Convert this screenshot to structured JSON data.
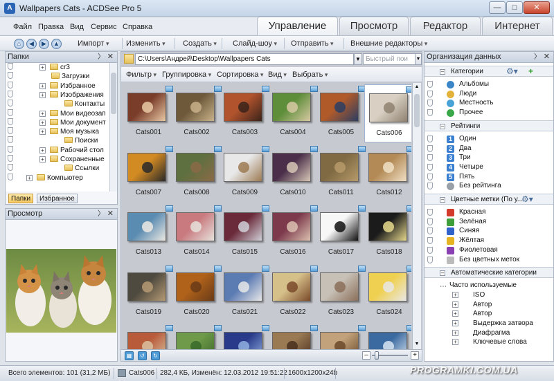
{
  "window": {
    "title": "Wallpapers Cats - ACDSee Pro 5"
  },
  "menu": [
    "Файл",
    "Правка",
    "Вид",
    "Сервис",
    "Справка"
  ],
  "modes": [
    "Управление",
    "Просмотр",
    "Редактор",
    "Интернет"
  ],
  "toolbar": [
    "Импорт",
    "Изменить",
    "Создать",
    "Слайд-шоу",
    "Отправить",
    "Внешние редакторы"
  ],
  "folders_panel": {
    "title": "Папки",
    "items": [
      "сr3",
      "Загрузки",
      "Избранное",
      "Изображения",
      "Контакты",
      "Мои видеозап",
      "Мои документ",
      "Моя музыка",
      "Поиски",
      "Рабочий стол",
      "Сохраненные",
      "Ссылки",
      "Компьютер"
    ],
    "tabs": [
      "Папки",
      "Избранное"
    ]
  },
  "preview_panel": {
    "title": "Просмотр"
  },
  "browser": {
    "path": "C:\\Users\\Андрей\\Desktop\\Wallpapers Cats",
    "search_placeholder": "Быстрый пои",
    "filters": [
      "Фильтр",
      "Группировка",
      "Сортировка",
      "Вид",
      "Выбрать"
    ],
    "selected": "Cats006",
    "thumbs": [
      "Cats001",
      "Cats002",
      "Cats003",
      "Cats004",
      "Cats005",
      "Cats006",
      "Cats007",
      "Cats008",
      "Cats009",
      "Cats010",
      "Cats011",
      "Cats012",
      "Cats013",
      "Cats014",
      "Cats015",
      "Cats016",
      "Cats017",
      "Cats018",
      "Cats019",
      "Cats020",
      "Cats021",
      "Cats022",
      "Cats023",
      "Cats024",
      "",
      "",
      "",
      "",
      "",
      ""
    ]
  },
  "organizer": {
    "title": "Организация данных",
    "categories_label": "Категории",
    "categories": [
      "Альбомы",
      "Люди",
      "Местность",
      "Прочее"
    ],
    "ratings_label": "Рейтинги",
    "ratings": [
      "Один",
      "Два",
      "Три",
      "Четыре",
      "Пять",
      "Без рейтинга"
    ],
    "rating_icons": [
      "1",
      "2",
      "3",
      "4",
      "5",
      ""
    ],
    "labels_label": "Цветные метки (По у...",
    "labels": [
      {
        "name": "Красная",
        "color": "#d33a2c"
      },
      {
        "name": "Зелёная",
        "color": "#3e9e3a"
      },
      {
        "name": "Синяя",
        "color": "#2f63c9"
      },
      {
        "name": "Жёлтая",
        "color": "#e6b422"
      },
      {
        "name": "Фиолетовая",
        "color": "#8a3fb3"
      },
      {
        "name": "Без цветных меток",
        "color": "#bbbbbb"
      }
    ],
    "auto_label": "Автоматические категории",
    "auto_group": "Часто используемые",
    "auto_items": [
      "ISO",
      "Автор",
      "Автор",
      "Выдержка затвора",
      "Диафрагма",
      "Ключевые слова"
    ]
  },
  "status": {
    "total": "Всего элементов: 101  (31,2 МБ)",
    "file": "Cats006",
    "info": "282,4 КБ, Изменён: 12.03.2012 19:51:22",
    "dims": "1600x1200x24b"
  },
  "watermark": "PROGRAMKI.COM.UA",
  "accent": "#f5c961"
}
